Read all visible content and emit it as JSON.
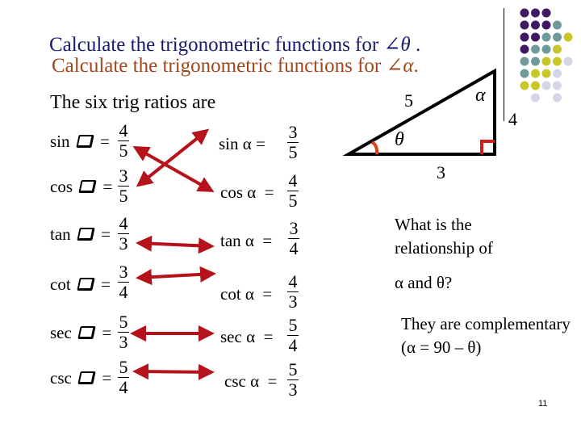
{
  "header": {
    "title_theta_prefix": "Calculate the trigonometric functions for ",
    "title_theta_symbol": "∠θ",
    "title_theta_suffix": " .",
    "title_alpha_prefix": "Calculate the trigonometric functions for ",
    "title_alpha_symbol": "∠α",
    "title_alpha_suffix": ".",
    "subtitle": "The six trig ratios are"
  },
  "colors": {
    "title_theta": "#1a1a6e",
    "title_alpha": "#a0471d",
    "arrow": "#b5121b",
    "angle_marker": "#d9441f",
    "right_angle_marker": "#d01c1c"
  },
  "theta_ratios": [
    {
      "fn": "sin",
      "equals": "=",
      "num": "4",
      "den": "5"
    },
    {
      "fn": "cos",
      "equals": "=",
      "num": "3",
      "den": "5"
    },
    {
      "fn": "tan",
      "equals": "=",
      "num": "4",
      "den": "3"
    },
    {
      "fn": "cot",
      "equals": "=",
      "num": "3",
      "den": "4"
    },
    {
      "fn": "sec",
      "equals": "=",
      "num": "5",
      "den": "3"
    },
    {
      "fn": "csc",
      "equals": "=",
      "num": "5",
      "den": "4"
    }
  ],
  "alpha_ratios": [
    {
      "label": "sin α =",
      "num": "3",
      "den": "5"
    },
    {
      "label": "cos α  =",
      "num": "4",
      "den": "5"
    },
    {
      "label": "tan α  =",
      "num": "3",
      "den": "4"
    },
    {
      "label": "cot α  =",
      "num": "4",
      "den": "3"
    },
    {
      "label": "sec α  =",
      "num": "5",
      "den": "4"
    },
    {
      "label": "csc α  =",
      "num": "5",
      "den": "3"
    }
  ],
  "triangle": {
    "hypotenuse": "5",
    "opposite_side": "4",
    "adjacent_side": "3",
    "angle_alpha": "α",
    "angle_theta": "θ"
  },
  "question": {
    "line1": "What is the relationship of",
    "line2": "α and θ?"
  },
  "answer": {
    "text": "They are complementary (α  =  90 – θ)"
  },
  "footer": {
    "page_number": "11"
  },
  "decor": {
    "dot_grid_colors": [
      "#3f1a63",
      "#6f9a9c",
      "#c9c62a",
      "#d4d6e8"
    ]
  }
}
